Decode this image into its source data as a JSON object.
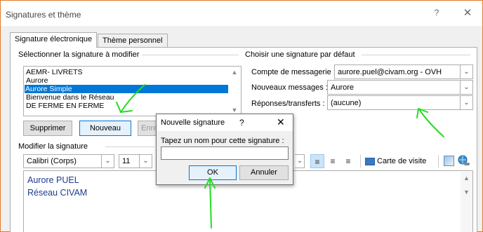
{
  "window": {
    "title": "Signatures et thème",
    "help_glyph": "?",
    "close_glyph": "✕"
  },
  "tabs": [
    {
      "label": "Signature électronique",
      "selected": true
    },
    {
      "label": "Thème personnel",
      "selected": false
    }
  ],
  "select_group": {
    "label": "Sélectionner la signature à modifier",
    "items": [
      "AEMR- LIVRETS",
      "Aurore",
      "Aurore Simple",
      "Bienvenue dans le Réseau",
      "DE FERME EN FERME"
    ],
    "selected": "Aurore Simple",
    "delete_label": "Supprimer",
    "new_label": "Nouveau",
    "save_label_partial": "Enre"
  },
  "default_group": {
    "label": "Choisir une signature par défaut",
    "account_label": "Compte de messagerie :",
    "account_value": "aurore.puel@civam.org - OVH",
    "new_messages_label": "Nouveaux messages :",
    "new_messages_value": "Aurore",
    "replies_label": "Réponses/transferts :",
    "replies_value": "(aucune)"
  },
  "edit_group": {
    "label": "Modifier la signature",
    "font": "Calibri (Corps)",
    "size": "11",
    "business_card": "Carte de visite",
    "lines": [
      "Aurore PUEL",
      "Réseau CIVAM"
    ]
  },
  "dialog": {
    "title": "Nouvelle signature",
    "help_glyph": "?",
    "close_glyph": "✕",
    "prompt": "Tapez un nom pour cette signature :",
    "input_value": "",
    "ok_label": "OK",
    "cancel_label": "Annuler"
  },
  "colors": {
    "annotation": "#22dd22",
    "selection": "#0078d7",
    "signature_text": "#1f3b8f",
    "window_border": "#e07a2a"
  }
}
